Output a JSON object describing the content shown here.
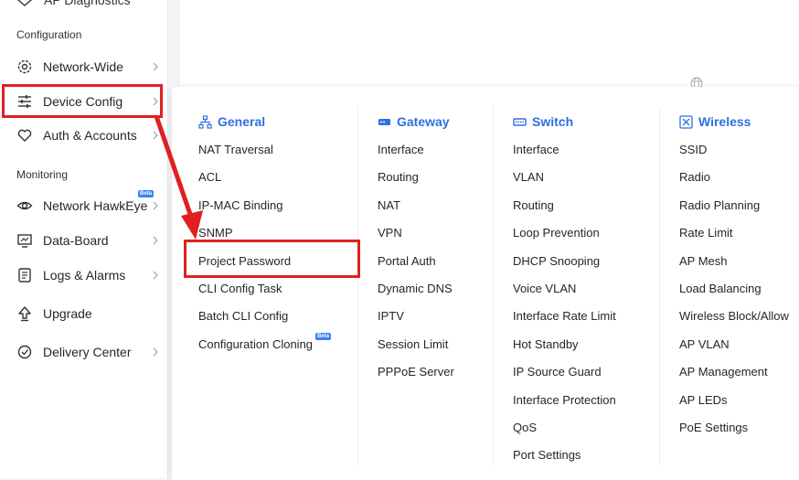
{
  "sidebar": {
    "cut_item": "AP Diagnostics",
    "sections": {
      "configuration": "Configuration",
      "monitoring": "Monitoring"
    },
    "items": [
      {
        "label": "Network-Wide"
      },
      {
        "label": "Device Config"
      },
      {
        "label": "Auth & Accounts"
      },
      {
        "label": "Network HawkEye",
        "badge": "Beta"
      },
      {
        "label": "Data-Board"
      },
      {
        "label": "Logs & Alarms"
      },
      {
        "label": "Upgrade"
      },
      {
        "label": "Delivery Center"
      }
    ]
  },
  "menu": {
    "columns": [
      {
        "title": "General",
        "icon": "sitemap-icon",
        "items": [
          "NAT Traversal",
          "ACL",
          "IP-MAC Binding",
          "SNMP",
          "Project Password",
          "CLI Config Task",
          "Batch CLI Config",
          "Configuration Cloning"
        ],
        "badge": "Beta"
      },
      {
        "title": "Gateway",
        "icon": "gateway-icon",
        "items": [
          "Interface",
          "Routing",
          "NAT",
          "VPN",
          "Portal Auth",
          "Dynamic DNS",
          "IPTV",
          "Session Limit",
          "PPPoE Server"
        ]
      },
      {
        "title": "Switch",
        "icon": "switch-icon",
        "items": [
          "Interface",
          "VLAN",
          "Routing",
          "Loop Prevention",
          "DHCP Snooping",
          "Voice VLAN",
          "Interface Rate Limit",
          "Hot Standby",
          "IP Source Guard",
          "Interface Protection",
          "QoS",
          "Port Settings"
        ]
      },
      {
        "title": "Wireless",
        "icon": "wireless-icon",
        "items": [
          "SSID",
          "Radio",
          "Radio Planning",
          "Rate Limit",
          "AP Mesh",
          "Load Balancing",
          "Wireless Block/Allow",
          "AP VLAN",
          "AP Management",
          "AP LEDs",
          "PoE Settings"
        ]
      }
    ]
  },
  "colors": {
    "accent": "#2e6fe0",
    "annotation_red": "#e02020"
  }
}
